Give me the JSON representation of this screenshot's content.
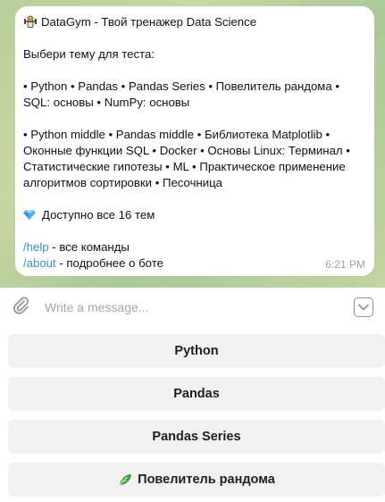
{
  "message": {
    "title": "DataGym - Твой тренажер Data Science",
    "prompt": "Выбери тему для теста:",
    "topics_line1": "• Python • Pandas • Pandas Series • Повелитель рандома •",
    "topics_line2": "SQL: основы • NumPy: основы",
    "topics_line3": "• Python middle • Pandas middle • Библиотека Matplotlib •",
    "topics_line4": "Оконные функции SQL • Docker • Основы Linux: Терминал •",
    "topics_line5": "Статистические гипотезы • ML • Практическое применение",
    "topics_line6": "алгоритмов сортировки • Песочница",
    "available": "Доступно все 16 тем",
    "help_cmd": "/help",
    "help_text": " - все команды",
    "about_cmd": "/about",
    "about_text": " - подробнее о боте",
    "time": "6:21 PM"
  },
  "composer": {
    "placeholder": "Write a message..."
  },
  "keyboard": {
    "buttons": [
      "Python",
      "Pandas",
      "Pandas Series",
      "Повелитель рандома"
    ]
  },
  "icons": {
    "logo": "gym-robot-icon",
    "gem": "gem-icon",
    "attach": "paperclip-icon",
    "keyboard_toggle": "chevron-down-icon",
    "leaf": "leaf-icon"
  },
  "colors": {
    "link": "#3a8fd1",
    "gem": "#4fb3e8",
    "leaf": "#3f9b3a"
  }
}
